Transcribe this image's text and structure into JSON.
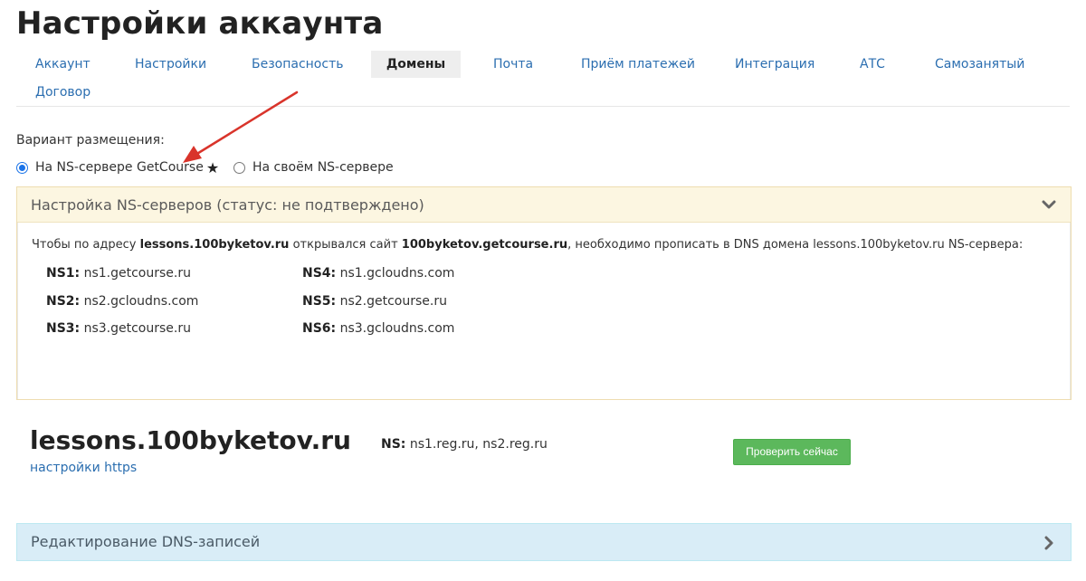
{
  "page": {
    "title": "Настройки аккаунта"
  },
  "tabs": [
    {
      "label": "Аккаунт",
      "active": false
    },
    {
      "label": "Настройки",
      "active": false
    },
    {
      "label": "Безопасность",
      "active": false
    },
    {
      "label": "Домены",
      "active": true
    },
    {
      "label": "Почта",
      "active": false
    },
    {
      "label": "Приём платежей",
      "active": false
    },
    {
      "label": "Интеграция",
      "active": false
    },
    {
      "label": "АТС",
      "active": false
    },
    {
      "label": "Самозанятый",
      "active": false
    },
    {
      "label": "Договор",
      "active": false
    }
  ],
  "placement": {
    "label": "Вариант размещения:",
    "options": [
      {
        "label": "На NS-сервере GetCourse",
        "checked": true,
        "starred": true
      },
      {
        "label": "На своём NS-сервере",
        "checked": false,
        "starred": false
      }
    ],
    "star": "★"
  },
  "ns_panel": {
    "title": "Настройка NS-серверов (статус: не подтверждено)",
    "intro": {
      "part1": "Чтобы по адресу ",
      "domain": "lessons.100byketov.ru",
      "part2": " открывался сайт ",
      "site": "100byketov.getcourse.ru",
      "part3": ", необходимо прописать в DNS домена lessons.100byketov.ru NS-сервера:"
    },
    "servers": [
      {
        "label": "NS1:",
        "value": "ns1.getcourse.ru"
      },
      {
        "label": "NS2:",
        "value": "ns2.gcloudns.com"
      },
      {
        "label": "NS3:",
        "value": "ns3.getcourse.ru"
      },
      {
        "label": "NS4:",
        "value": "ns1.gcloudns.com"
      },
      {
        "label": "NS5:",
        "value": "ns2.getcourse.ru"
      },
      {
        "label": "NS6:",
        "value": "ns3.gcloudns.com"
      }
    ]
  },
  "domain": {
    "name": "lessons.100byketov.ru",
    "https_link": "настройки https",
    "ns_label": "NS:",
    "ns_value": "ns1.reg.ru, ns2.reg.ru",
    "check_button": "Проверить сейчас"
  },
  "dns_panel": {
    "title": "Редактирование DNS-записей"
  },
  "colors": {
    "link": "#2b6eb0",
    "warning_panel": "#fcf6e1",
    "info_panel": "#d9edf7",
    "success_button": "#5cb85c",
    "annotation_arrow": "#d9342b"
  },
  "icons": {
    "ns_panel_toggle": "chevron-down-icon",
    "dns_panel_toggle": "chevron-right-icon",
    "annotation": "red-arrow-icon"
  }
}
